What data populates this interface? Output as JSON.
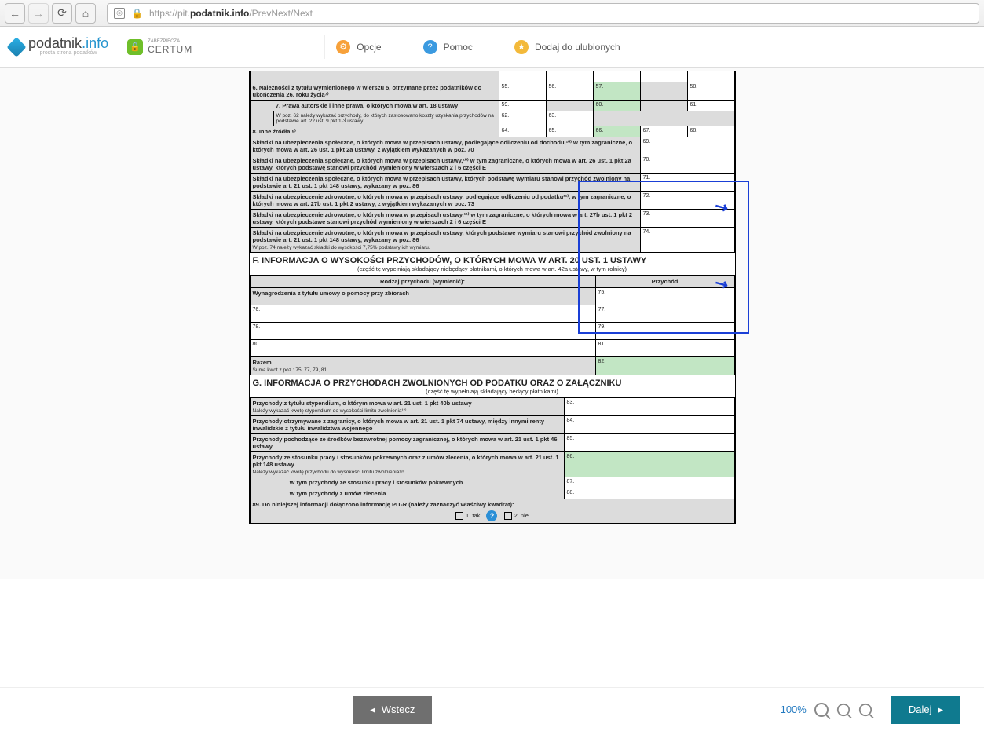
{
  "browser": {
    "url": "https://pit.podatnik.info/PrevNext/Next",
    "host": "podatnik.info"
  },
  "logo": {
    "brand_a": "podatnik",
    "brand_b": ".info",
    "sub": "prosta strona podatków"
  },
  "certum": {
    "top": "ZABEZPIECZA",
    "name": "CERTUM"
  },
  "toolbar": {
    "opcje": "Opcje",
    "pomoc": "Pomoc",
    "fav": "Dodaj do ulubionych"
  },
  "rows": {
    "r6": {
      "label": "6. Należności z tytułu wymienionego w wierszu 5, otrzymane przez podatników do ukończenia 26. roku życia⁷⁾",
      "c1": "55.",
      "c2": "56.",
      "c3": "57.",
      "c4": "",
      "c5": "58."
    },
    "r7": {
      "label": "7. Prawa autorskie i inne prawa, o których mowa w art. 18 ustawy",
      "c1": "59.",
      "c2": "",
      "c3": "60.",
      "c4": "",
      "c5": "61."
    },
    "r7b": {
      "label": "W poz. 62 należy wykazać przychody, do których zastosowano koszty uzyskania przychodów na podstawie art. 22 ust. 9 pkt 1-3 ustawy",
      "c1": "62.",
      "c2": "63."
    },
    "r8": {
      "label": "8. Inne źródła ⁸⁾",
      "c1": "64.",
      "c2": "65.",
      "c3": "66.",
      "c4": "67.",
      "c5": "68."
    },
    "s69": {
      "t": "Składki na ubezpieczenia społeczne, o których mowa w przepisach ustawy, podlegające odliczeniu od dochodu,¹⁰⁾ w tym zagraniczne, o których mowa w art. 26 ust. 1 pkt 2a ustawy, z wyjątkiem wykazanych w poz. 70",
      "n": "69."
    },
    "s70": {
      "t": "Składki na ubezpieczenia społeczne, o których mowa w przepisach ustawy,¹⁰⁾ w tym zagraniczne, o których mowa w art. 26 ust. 1 pkt 2a ustawy, których podstawę stanowi przychód wymieniony w wierszach 2 i 6 części E",
      "n": "70."
    },
    "s71": {
      "t": "Składki na ubezpieczenia społeczne, o których mowa w przepisach ustawy, których podstawę wymiaru stanowi przychód zwolniony na podstawie art. 21 ust. 1 pkt 148 ustawy, wykazany w poz. 86",
      "n": "71."
    },
    "s72": {
      "t": "Składki na ubezpieczenie zdrowotne, o których mowa w przepisach ustawy, podlegające odliczeniu od podatku¹¹⁾, w tym zagraniczne, o których mowa w art. 27b ust. 1 pkt 2 ustawy, z wyjątkiem wykazanych w poz. 73",
      "n": "72."
    },
    "s73": {
      "t": "Składki na ubezpieczenie zdrowotne, o których mowa w przepisach ustawy,¹¹⁾ w tym zagraniczne, o których mowa w art. 27b ust. 1 pkt 2 ustawy, których podstawę stanowi przychód wymieniony w wierszach 2 i 6 części E",
      "n": "73."
    },
    "s74": {
      "t": "Składki na ubezpieczenie zdrowotne, o których mowa w przepisach ustawy, których podstawę wymiaru stanowi przychód zwolniony na podstawie art. 21 ust. 1 pkt 148 ustawy, wykazany w poz. 86",
      "n": "74.",
      "foot": "W poz. 74 należy wykazać składki do wysokości 7,75% podstawy ich wymiaru."
    }
  },
  "F": {
    "title": "F. INFORMACJA O WYSOKOŚCI PRZYCHODÓW, O KTÓRYCH MOWA W ART. 20 UST. 1 USTAWY",
    "sub": "(część tę wypełniają składający niebędący płatnikami, o których mowa w art. 42a ustawy, w tym rolnicy)",
    "col1": "Rodzaj przychodu (wymienić):",
    "col2": "Przychód",
    "row1": "Wynagrodzenia z tytułu umowy o pomocy przy zbiorach",
    "n75": "75.",
    "n76": "76.",
    "n77": "77.",
    "n78": "78.",
    "n79": "79.",
    "n80": "80.",
    "n81": "81.",
    "n82": "82.",
    "razem": "Razem",
    "sum": "Suma kwot z poz.: 75, 77, 79, 81."
  },
  "G": {
    "title": "G. INFORMACJA O PRZYCHODACH ZWOLNIONYCH OD PODATKU ORAZ O ZAŁĄCZNIKU",
    "sub": "(część tę wypełniają składający będący płatnikami)",
    "r83": {
      "t": "Przychody z tytułu stypendium, o którym mowa w art. 21 ust. 1 pkt 40b ustawy",
      "f": "Należy wykazać kwotę stypendium do wysokości limitu zwolnienia¹²⁾",
      "n": "83."
    },
    "r84": {
      "t": "Przychody otrzymywane z zagranicy, o których mowa w art. 21 ust. 1 pkt 74 ustawy, między innymi renty inwalidzkie z tytułu inwalidztwa wojennego",
      "n": "84."
    },
    "r85": {
      "t": "Przychody pochodzące ze środków bezzwrotnej pomocy zagranicznej, o których mowa w art. 21 ust. 1 pkt 46 ustawy",
      "n": "85."
    },
    "r86": {
      "t": "Przychody ze stosunku pracy i stosunków pokrewnych oraz z umów zlecenia, o których mowa w art. 21 ust. 1 pkt 148 ustawy",
      "f": "Należy wykazać kwotę przychodu do wysokości limitu zwolnienia¹³⁾",
      "n": "86."
    },
    "r87": {
      "t": "W tym przychody ze stosunku pracy i stosunków pokrewnych",
      "n": "87."
    },
    "r88": {
      "t": "W tym przychody z umów zlecenia",
      "n": "88."
    },
    "r89": "89. Do niniejszej informacji dołączono informację PIT-R (należy zaznaczyć właściwy kwadrat):",
    "opt1": "1. tak",
    "opt2": "2. nie"
  },
  "footer": {
    "back": "Wstecz",
    "next": "Dalej",
    "zoom": "100%"
  }
}
